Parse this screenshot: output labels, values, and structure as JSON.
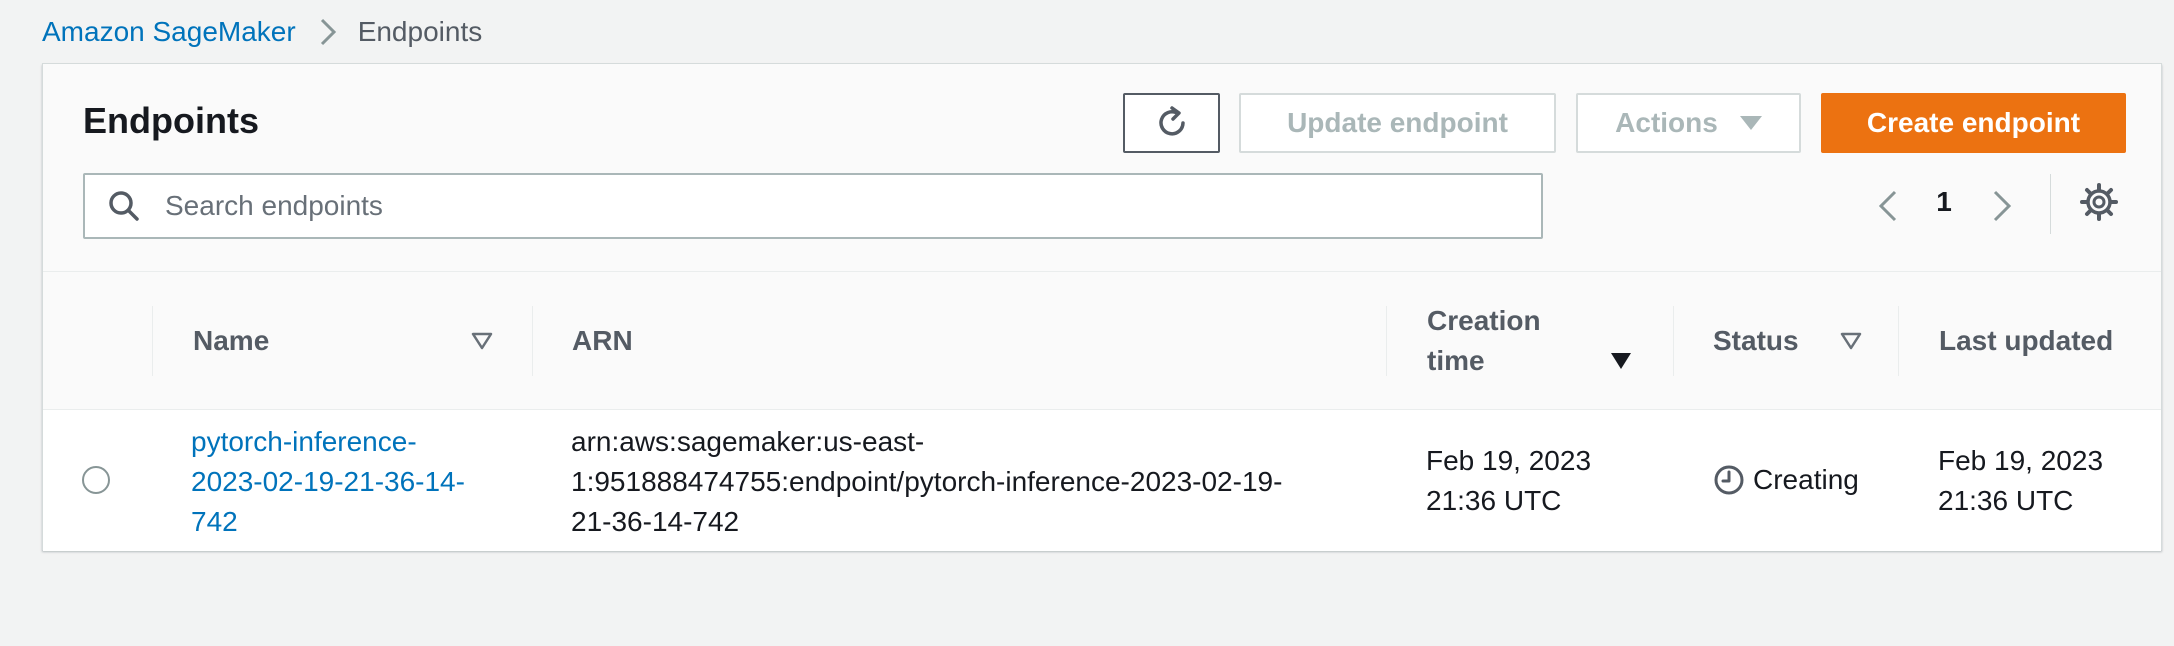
{
  "breadcrumb": {
    "parent": "Amazon SageMaker",
    "current": "Endpoints"
  },
  "panel": {
    "title": "Endpoints",
    "buttons": {
      "update": "Update endpoint",
      "actions": "Actions",
      "create": "Create endpoint"
    },
    "search": {
      "placeholder": "Search endpoints",
      "value": ""
    },
    "pagination": {
      "page": "1"
    }
  },
  "table": {
    "columns": {
      "name": "Name",
      "arn": "ARN",
      "creation_line1": "Creation",
      "creation_line2": "time",
      "status": "Status",
      "last_updated": "Last updated"
    },
    "rows": [
      {
        "name_lines": [
          "pytorch-inference-",
          "2023-02-19-21-36-14-",
          "742"
        ],
        "arn_lines": [
          "arn:aws:sagemaker:us-east-",
          "1:951888474755:endpoint/pytorch-inference-2023-02-19-",
          "21-36-14-742"
        ],
        "creation_lines": [
          "Feb 19, 2023",
          "21:36 UTC"
        ],
        "status": "Creating",
        "updated_lines": [
          "Feb 19, 2023",
          "21:36 UTC"
        ]
      }
    ]
  },
  "colors": {
    "link": "#0073bb",
    "primary_button": "#ec7211",
    "disabled_text": "#aab7b8"
  },
  "icons": [
    "chevron-right-icon",
    "refresh-icon",
    "caret-down-icon",
    "search-icon",
    "chevron-left-icon",
    "settings-icon",
    "sort-icon",
    "clock-icon"
  ]
}
